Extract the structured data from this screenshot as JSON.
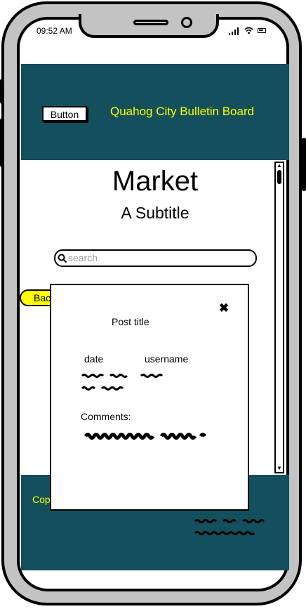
{
  "status_bar": {
    "time": "09:52 AM"
  },
  "header": {
    "button_label": "Button",
    "title": "Quahog City Bulletin Board"
  },
  "page": {
    "title": "Market",
    "subtitle": "A Subtitle"
  },
  "search": {
    "placeholder": "search"
  },
  "back_tag": {
    "label": "Back"
  },
  "footer": {
    "copyright": "Copyright"
  },
  "modal": {
    "title": "Post title",
    "date_label": "date",
    "username_label": "username",
    "comments_label": "Comments:"
  },
  "icons": {
    "search": "search-icon",
    "close": "close-icon",
    "signal": "signal-icon",
    "wifi": "wifi-icon",
    "battery": "battery-icon",
    "scroll_up": "scroll-up-arrow-icon",
    "scroll_down": "scroll-down-arrow-icon"
  },
  "colors": {
    "header_bg": "#134f5c",
    "accent_text": "#ffff00",
    "phone_frame": "#c3c3c3"
  }
}
